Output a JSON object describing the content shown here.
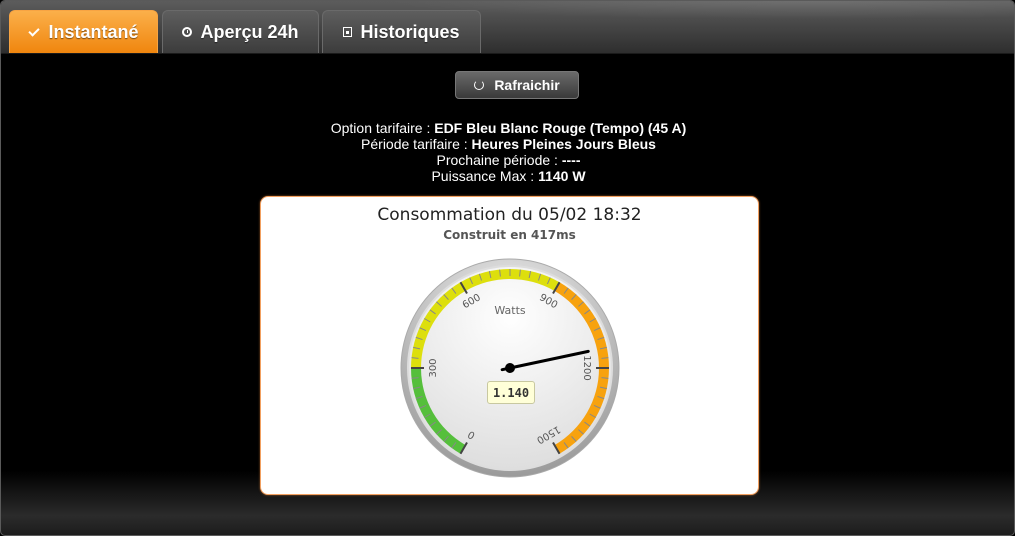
{
  "tabs": [
    {
      "label": "Instantané",
      "icon": "check-icon",
      "active": true
    },
    {
      "label": "Aperçu 24h",
      "icon": "clock-icon",
      "active": false
    },
    {
      "label": "Historiques",
      "icon": "calendar-icon",
      "active": false
    }
  ],
  "refresh_button": {
    "label": "Rafraichir",
    "icon": "refresh-icon"
  },
  "info": {
    "option_label": "Option tarifaire :",
    "option_value": "EDF Bleu Blanc Rouge (Tempo) (45 A)",
    "periode_label": "Période tarifaire :",
    "periode_value": "Heures Pleines Jours Bleus",
    "prochaine_label": "Prochaine période :",
    "prochaine_value": "----",
    "puissance_label": "Puissance Max :",
    "puissance_value": "1140 W"
  },
  "chart_data": {
    "type": "gauge",
    "title": "Consommation du 05/02 18:32",
    "subtitle": "Construit en 417ms",
    "unit_label": "Watts",
    "min": 0,
    "max": 1500,
    "value": 1140,
    "value_label": "1.140",
    "tick_labels": [
      "0",
      "300",
      "600",
      "900",
      "1200",
      "1500"
    ],
    "bands": [
      {
        "from": 0,
        "to": 300,
        "color": "#55bf3b"
      },
      {
        "from": 300,
        "to": 900,
        "color": "#dddf0d"
      },
      {
        "from": 900,
        "to": 1500,
        "color": "#f7a20e"
      }
    ]
  },
  "colors": {
    "accent": "#f0860e",
    "panel_border": "#f2a060"
  }
}
